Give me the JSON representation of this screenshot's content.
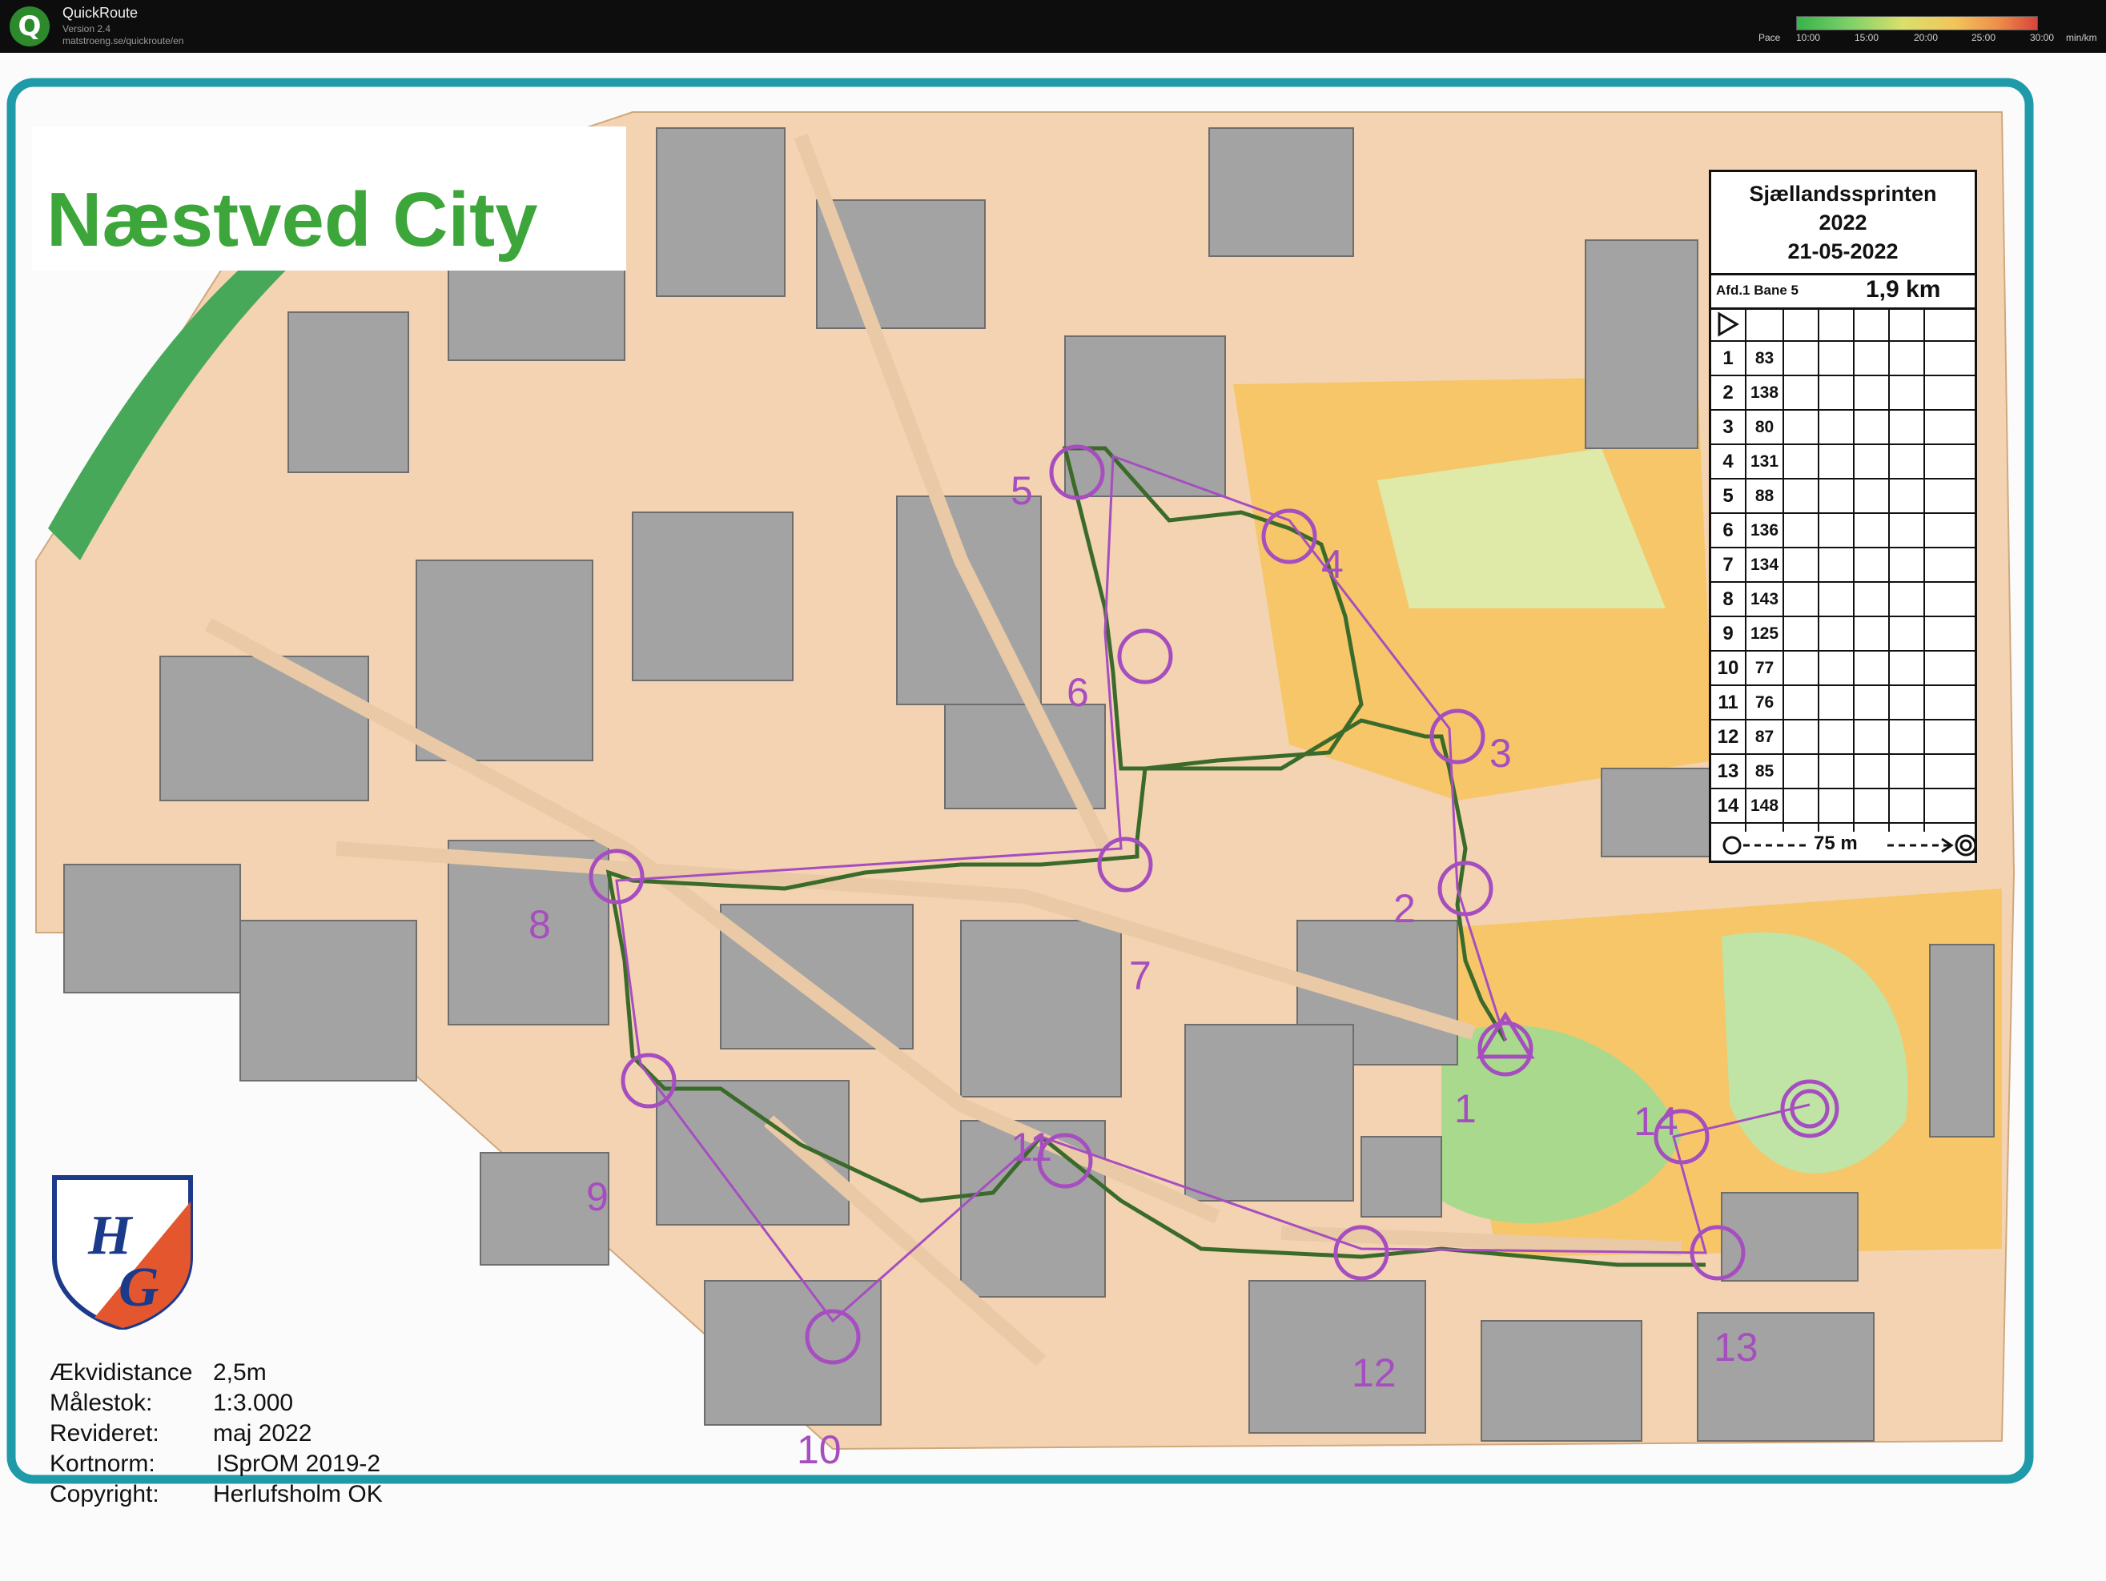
{
  "app": {
    "name": "QuickRoute",
    "version": "Version 2.4",
    "url": "matstroeng.se/quickroute/en",
    "pace_label": "Pace",
    "pace_ticks": [
      "10:00",
      "15:00",
      "20:00",
      "25:00",
      "30:00"
    ],
    "pace_unit": "min/km"
  },
  "map": {
    "title": "Næstved City",
    "info": [
      {
        "key": "Ækvidistance",
        "value": "2,5m"
      },
      {
        "key": "Målestok:",
        "value": "1:3.000"
      },
      {
        "key": "Revideret:",
        "value": "maj  2022"
      },
      {
        "key": "Kortnorm:",
        "value": "ISprOM 2019-2"
      },
      {
        "key": "Copyright:",
        "value": "Herlufsholm OK"
      }
    ],
    "club_logo_letters": "HG",
    "colors": {
      "frame": "#1f9aa8",
      "course": "#a64ec0",
      "title": "#3da63a",
      "route": "#3a6b2a"
    }
  },
  "controls": [
    "1",
    "2",
    "3",
    "4",
    "5",
    "6",
    "7",
    "8",
    "9",
    "10",
    "11",
    "12",
    "13",
    "14"
  ],
  "description_sheet": {
    "event": "Sjællandssprinten",
    "year": "2022",
    "date": "21-05-2022",
    "course": "Afd.1 Bane 5",
    "length": "1,9 km",
    "rows": [
      {
        "num": "1",
        "code": "83"
      },
      {
        "num": "2",
        "code": "138"
      },
      {
        "num": "3",
        "code": "80"
      },
      {
        "num": "4",
        "code": "131"
      },
      {
        "num": "5",
        "code": "88"
      },
      {
        "num": "6",
        "code": "136"
      },
      {
        "num": "7",
        "code": "134"
      },
      {
        "num": "8",
        "code": "143"
      },
      {
        "num": "9",
        "code": "125"
      },
      {
        "num": "10",
        "code": "77"
      },
      {
        "num": "11",
        "code": "76"
      },
      {
        "num": "12",
        "code": "87"
      },
      {
        "num": "13",
        "code": "85"
      },
      {
        "num": "14",
        "code": "148"
      }
    ],
    "finish_distance": "75 m"
  }
}
